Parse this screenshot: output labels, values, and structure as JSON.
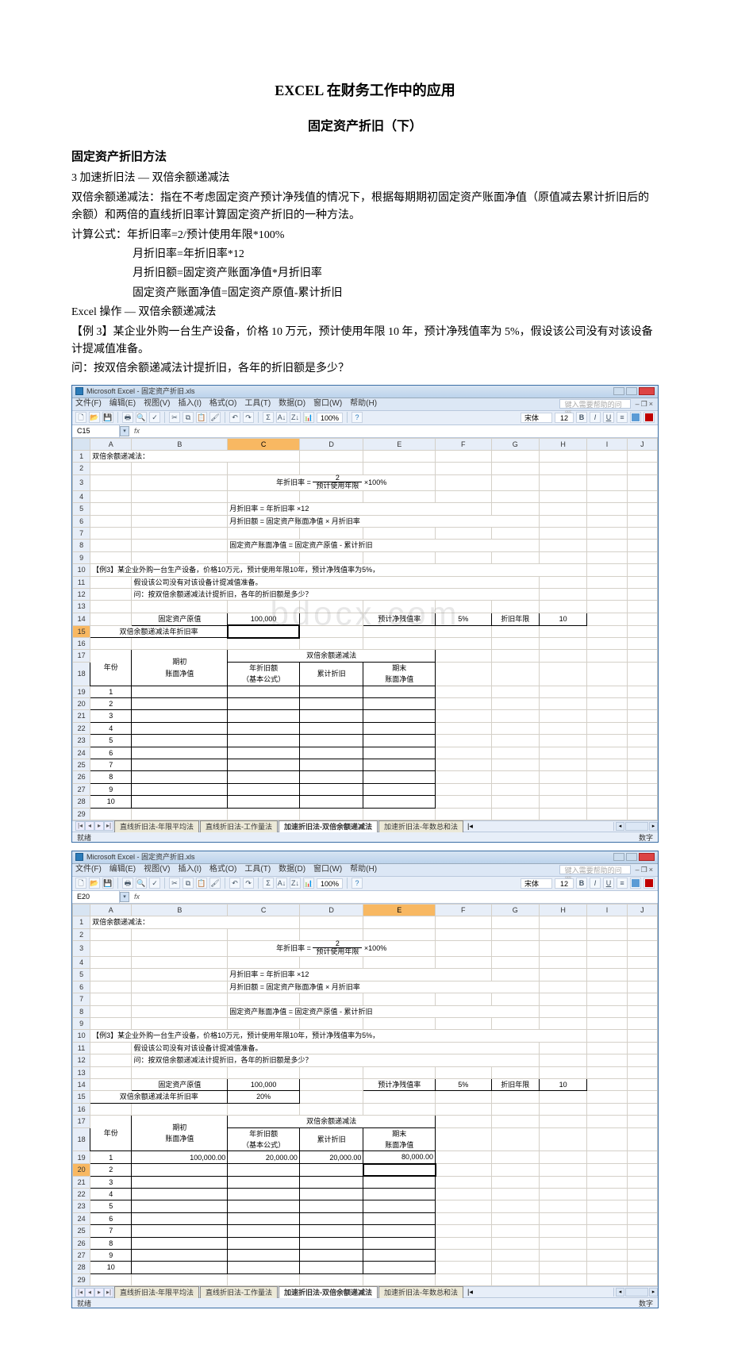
{
  "doc": {
    "title": "EXCEL 在财务工作中的应用",
    "subtitle": "固定资产折旧（下）",
    "section": "固定资产折旧方法",
    "p1": "3 加速折旧法 — 双倍余额递减法",
    "p2": "双倍余额递减法：指在不考虑固定资产预计净残值的情况下，根据每期期初固定资产账面净值（原值减去累计折旧后的余额）和两倍的直线折旧率计算固定资产折旧的一种方法。",
    "p3": "计算公式：年折旧率=2/预计使用年限*100%",
    "p4": "月折旧率=年折旧率*12",
    "p5": "月折旧额=固定资产账面净值*月折旧率",
    "p6": "固定资产账面净值=固定资产原值-累计折旧",
    "p7": "Excel 操作 — 双倍余额递减法",
    "p8": "【例 3】某企业外购一台生产设备，价格 10 万元，预计使用年限 10 年，预计净残值率为 5%，假设该公司没有对该设备计提减值准备。",
    "p9": "问：按双倍余额递减法计提折旧，各年的折旧额是多少？"
  },
  "excel1": {
    "title": "Microsoft Excel - 固定资产折旧.xls",
    "menus": [
      "文件(F)",
      "编辑(E)",
      "视图(V)",
      "插入(I)",
      "格式(O)",
      "工具(T)",
      "数据(D)",
      "窗口(W)",
      "帮助(H)"
    ],
    "help_placeholder": "键入需要帮助的问题",
    "zoom": "100%",
    "font": "宋体",
    "fontsize": "12",
    "namebox": "C15",
    "formula": "",
    "cols": [
      "A",
      "B",
      "C",
      "D",
      "E",
      "F",
      "G",
      "H",
      "I",
      "J"
    ],
    "r1_A": "双倍余额递减法：",
    "r3_formula_lead": "年折旧率 =",
    "r3_num": "2",
    "r3_den": "预计使用年限",
    "r3_tail": "×100%",
    "r5": "月折旧率 = 年折旧率 ×12",
    "r6": "月折旧额 = 固定资产账面净值 × 月折旧率",
    "r8": "固定资产账面净值 = 固定资产原值 - 累计折旧",
    "r10": "【例3】某企业外购一台生产设备，价格10万元，预计使用年限10年，预计净残值率为5%，",
    "r11": "假设该公司没有对该设备计提减值准备。",
    "r12": "问：按双倍余额递减法计提折旧，各年的折旧额是多少？",
    "r14_b": "固定资产原值",
    "r14_c": "100,000",
    "r14_e": "预计净残值率",
    "r14_f": "5%",
    "r14_g": "折旧年限",
    "r14_h": "10",
    "r15_a": "双倍余额递减法年折旧率",
    "r15_c": "",
    "r17_title": "双倍余额递减法",
    "hdr_year": "年份",
    "hdr_begin1": "期初",
    "hdr_begin2": "账面净值",
    "hdr_dep1": "年折旧额",
    "hdr_dep2": "（基本公式）",
    "hdr_acc": "累计折旧",
    "hdr_end1": "期末",
    "hdr_end2": "账面净值",
    "years": [
      "1",
      "2",
      "3",
      "4",
      "5",
      "6",
      "7",
      "8",
      "9",
      "10"
    ],
    "tabs": [
      "直线折旧法-年限平均法",
      "直线折旧法-工作量法",
      "加速折旧法-双倍余额递减法",
      "加速折旧法-年数总和法"
    ],
    "active_tab": 2,
    "status_left": "就绪",
    "status_right": "数字"
  },
  "excel2": {
    "title": "Microsoft Excel - 固定资产折旧.xls",
    "menus": [
      "文件(F)",
      "编辑(E)",
      "视图(V)",
      "插入(I)",
      "格式(O)",
      "工具(T)",
      "数据(D)",
      "窗口(W)",
      "帮助(H)"
    ],
    "help_placeholder": "键入需要帮助的问题",
    "zoom": "100%",
    "font": "宋体",
    "fontsize": "12",
    "namebox": "E20",
    "formula": "",
    "cols": [
      "A",
      "B",
      "C",
      "D",
      "E",
      "F",
      "G",
      "H",
      "I",
      "J"
    ],
    "r15_c": "20%",
    "row19": {
      "begin": "100,000.00",
      "dep": "20,000.00",
      "acc": "20,000.00",
      "end": "80,000.00"
    },
    "status_left": "就绪",
    "status_right": "数字"
  },
  "watermark": "bdocx.com"
}
